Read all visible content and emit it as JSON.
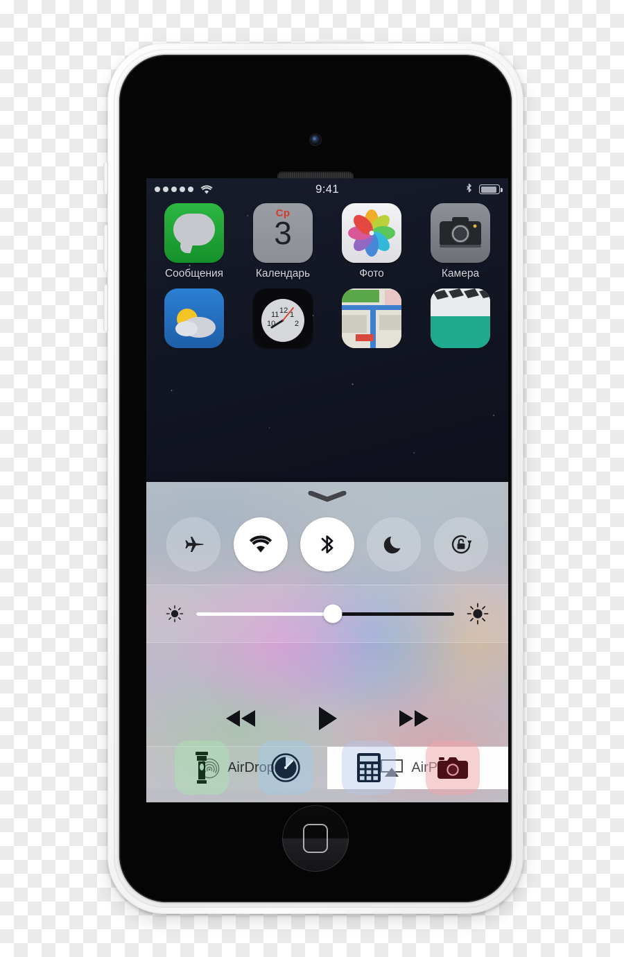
{
  "device": {
    "name": "iPhone 5c (white)",
    "body_color": "#f5f5f5",
    "buttons": {
      "power": "power-button",
      "mute": "mute-switch",
      "volume_up": "volume-up-button",
      "volume_down": "volume-down-button",
      "home": "home-button"
    }
  },
  "status_bar": {
    "signal_dots_filled": 5,
    "signal_dots_total": 5,
    "wifi": "wifi-icon",
    "time": "9:41",
    "bluetooth": "bluetooth-icon",
    "battery_percent": 88,
    "text_color": "#d3d5db"
  },
  "home_screen": {
    "wallpaper": "starfield",
    "rows": [
      {
        "apps": [
          {
            "label": "Сообщения",
            "icon": "messages-icon",
            "color": "#2cb742"
          },
          {
            "label": "Календарь",
            "icon": "calendar-icon",
            "color": "#9b9da4",
            "day_of_week": "Ср",
            "day_number": "3"
          },
          {
            "label": "Фото",
            "icon": "photos-icon",
            "color": "#f3f3f5"
          },
          {
            "label": "Камера",
            "icon": "camera-icon",
            "color": "#8f9199"
          }
        ]
      },
      {
        "apps": [
          {
            "label": "",
            "icon": "weather-icon",
            "color": "#2b7fd4"
          },
          {
            "label": "",
            "icon": "clock-icon",
            "color": "#0a0a0c"
          },
          {
            "label": "",
            "icon": "maps-icon",
            "color": "#e9e6de"
          },
          {
            "label": "",
            "icon": "videos-icon",
            "color": "#1fa98f"
          }
        ]
      }
    ]
  },
  "control_center": {
    "grabber": "chevron-down-grabber",
    "toggles": [
      {
        "name": "airplane-mode",
        "icon": "airplane-icon",
        "state": "off"
      },
      {
        "name": "wifi",
        "icon": "wifi-icon",
        "state": "on"
      },
      {
        "name": "bluetooth",
        "icon": "bluetooth-icon",
        "state": "on"
      },
      {
        "name": "do-not-disturb",
        "icon": "moon-icon",
        "state": "off"
      },
      {
        "name": "rotation-lock",
        "icon": "rotation-lock-icon",
        "state": "off"
      }
    ],
    "brightness": {
      "min_icon": "brightness-low-icon",
      "max_icon": "brightness-high-icon",
      "value_percent": 53
    },
    "media": {
      "rewind": "rewind-icon",
      "play": "play-icon",
      "forward": "fast-forward-icon",
      "state": "paused"
    },
    "share": {
      "airdrop_label": "AirDrop",
      "airdrop_icon": "airdrop-icon",
      "airdrop_selected": false,
      "airplay_label": "AirPlay",
      "airplay_icon": "airplay-icon",
      "airplay_selected": true,
      "highlight_color": "#fdfdfd"
    },
    "shortcuts": [
      {
        "name": "flashlight",
        "icon": "flashlight-icon",
        "tint": "#aae6b4"
      },
      {
        "name": "timer",
        "icon": "timer-icon",
        "tint": "#a0cdeb"
      },
      {
        "name": "calculator",
        "icon": "calculator-icon",
        "tint": "#b4c8eb"
      },
      {
        "name": "camera",
        "icon": "camera-icon",
        "tint": "#f0a5aa"
      }
    ]
  }
}
